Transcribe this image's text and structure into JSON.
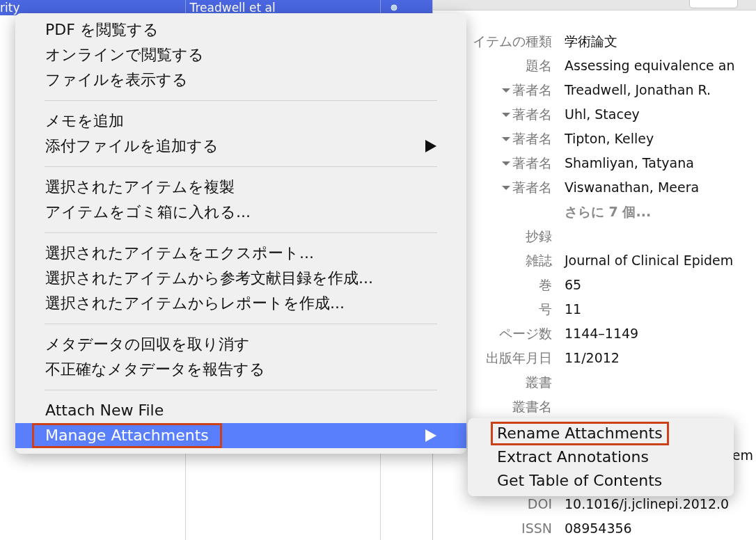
{
  "list_row": {
    "selected": true,
    "cells": [
      "rity",
      "Treadwell et al"
    ]
  },
  "info": [
    {
      "label": "イテムの種類",
      "value": "学術論文"
    },
    {
      "label": "題名",
      "value": "Assessing equivalence an"
    },
    {
      "label": "著者名",
      "value": "Treadwell, Jonathan R.",
      "kind": "author",
      "expanded": true
    },
    {
      "label": "著者名",
      "value": "Uhl, Stacey",
      "kind": "author",
      "expanded": true
    },
    {
      "label": "著者名",
      "value": "Tipton, Kelley",
      "kind": "author",
      "expanded": true
    },
    {
      "label": "著者名",
      "value": "Shamliyan, Tatyana",
      "kind": "author",
      "expanded": true
    },
    {
      "label": "著者名",
      "value": "Viswanathan, Meera",
      "kind": "author",
      "expanded": true
    },
    {
      "value": "さらに 7 個...",
      "kind": "more"
    },
    {
      "label": "抄録"
    },
    {
      "label": "雑誌",
      "value": "Journal of Clinical Epidem"
    },
    {
      "label": "巻",
      "value": "65"
    },
    {
      "label": "号",
      "value": "11"
    },
    {
      "label": "ページ数",
      "value": "1144–1149"
    },
    {
      "label": "出版年月日",
      "value": "11/2012"
    },
    {
      "label": "叢書"
    },
    {
      "label": "叢書名"
    },
    {
      "value": "em",
      "kind": "tail"
    },
    {
      "label": "DOI",
      "value": "10.1016/j.jclinepi.2012.0"
    },
    {
      "label": "ISSN",
      "value": "08954356"
    }
  ],
  "context_menu": {
    "groups": [
      [
        {
          "label": "PDF を閲覧する",
          "submenu": false,
          "selected": false
        },
        {
          "label": "オンラインで閲覧する",
          "submenu": false,
          "selected": false
        },
        {
          "label": "ファイルを表示する",
          "submenu": false,
          "selected": false
        }
      ],
      [
        {
          "label": "メモを追加",
          "submenu": false,
          "selected": false
        },
        {
          "label": "添付ファイルを追加する",
          "submenu": true,
          "selected": false
        }
      ],
      [
        {
          "label": "選択されたアイテムを複製",
          "submenu": false,
          "selected": false
        },
        {
          "label": "アイテムをゴミ箱に入れる...",
          "submenu": false,
          "selected": false
        }
      ],
      [
        {
          "label": "選択されたアイテムをエクスポート...",
          "submenu": false,
          "selected": false
        },
        {
          "label": "選択されたアイテムから参考文献目録を作成...",
          "submenu": false,
          "selected": false
        },
        {
          "label": "選択されたアイテムからレポートを作成...",
          "submenu": false,
          "selected": false
        }
      ],
      [
        {
          "label": "メタデータの回収を取り消す",
          "submenu": false,
          "selected": false
        },
        {
          "label": "不正確なメタデータを報告する",
          "submenu": false,
          "selected": false
        }
      ],
      [
        {
          "label": "Attach New File",
          "submenu": false,
          "selected": false
        },
        {
          "label": "Manage Attachments",
          "submenu": true,
          "selected": true,
          "outlined": true
        }
      ]
    ]
  },
  "submenu": [
    {
      "label": "Rename Attachments",
      "outlined": true
    },
    {
      "label": "Extract Annotations",
      "outlined": false
    },
    {
      "label": "Get Table of Contents",
      "outlined": false
    }
  ]
}
